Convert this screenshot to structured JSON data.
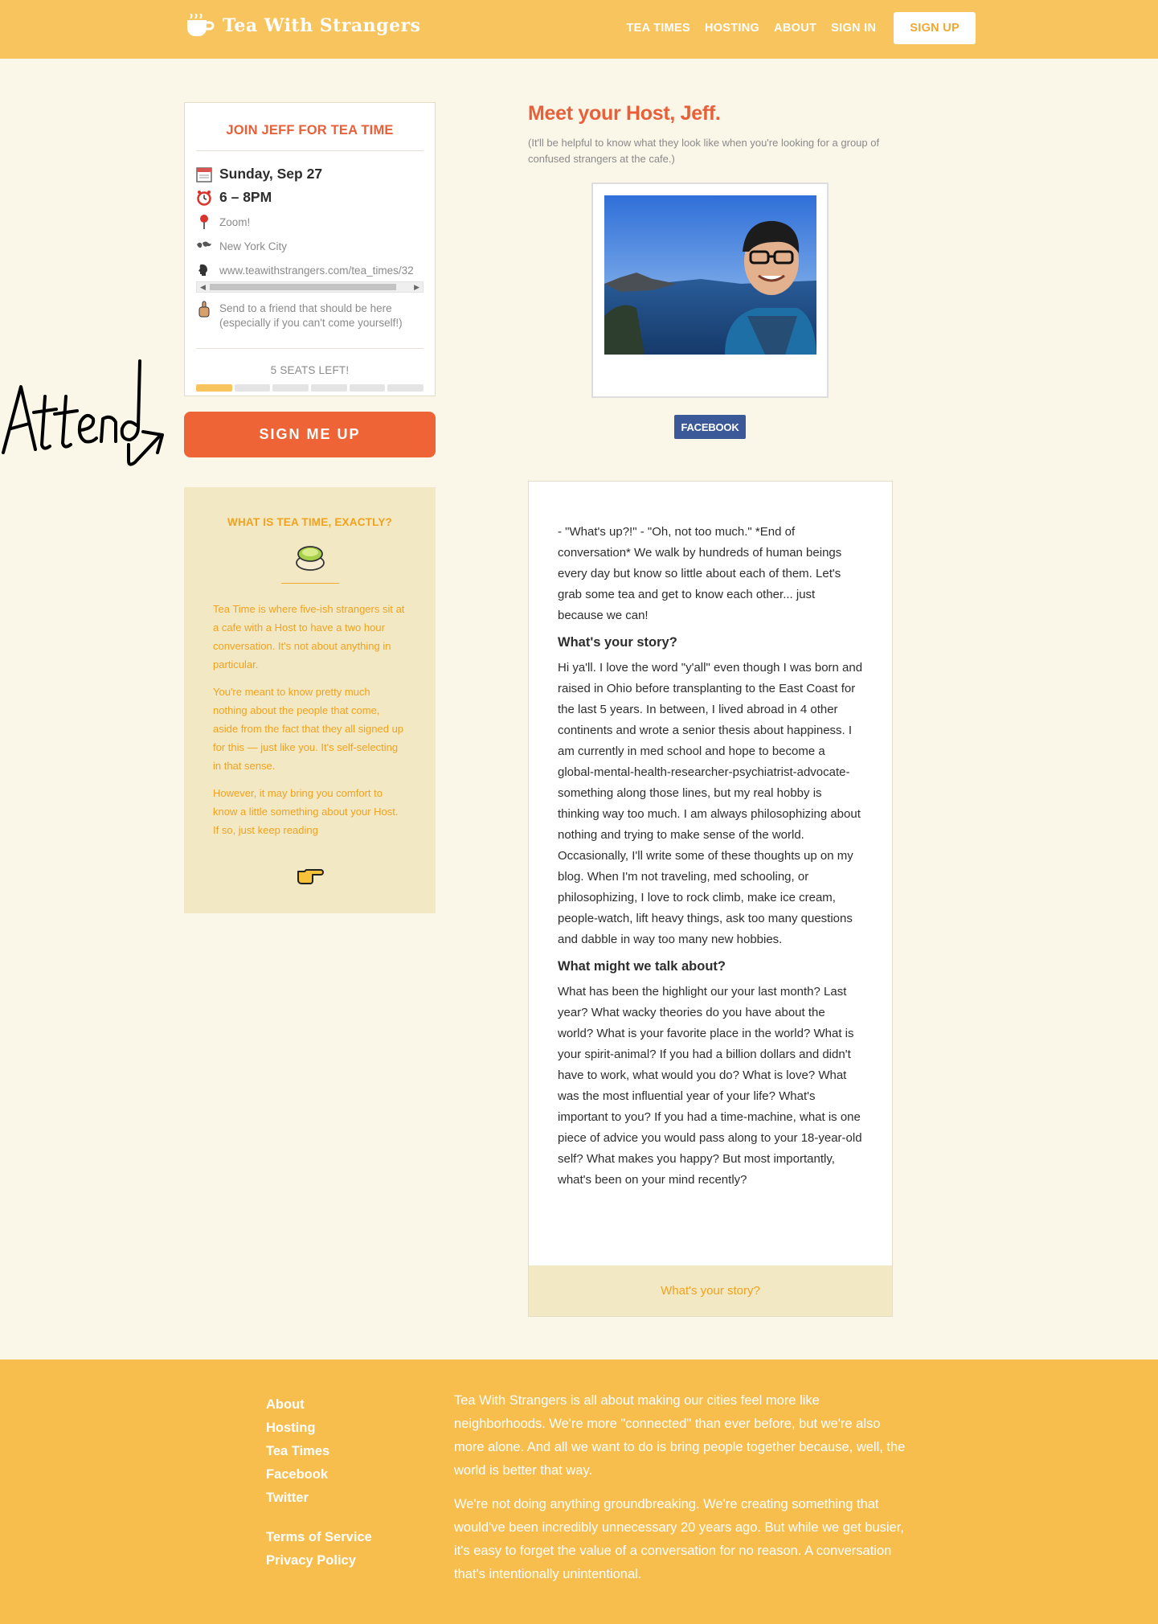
{
  "header": {
    "logo_text": "Tea With Strangers",
    "nav": {
      "tea_times": "TEA TIMES",
      "hosting": "HOSTING",
      "about": "ABOUT",
      "sign_in": "SIGN IN",
      "sign_up": "SIGN UP"
    }
  },
  "event_card": {
    "title": "JOIN JEFF FOR TEA TIME",
    "date": "Sunday, Sep 27",
    "time": "6 – 8PM",
    "location": "Zoom!",
    "city": "New York City",
    "url": "www.teawithstrangers.com/tea_times/32",
    "send_note_line1": "Send to a friend that should be here",
    "send_note_line2": "(especially if you can't come yourself!)",
    "seats_left": "5 SEATS LEFT!",
    "seats_filled_fraction": 0.1667,
    "icons": {
      "date": "calendar-icon",
      "time": "alarm-clock-icon",
      "location": "pushpin-icon",
      "city": "world-map-icon",
      "url": "speaking-head-icon",
      "send": "pointing-finger-icon"
    }
  },
  "sign_me_up_label": "SIGN ME UP",
  "scribble_text": "Attend",
  "explain": {
    "title": "WHAT IS TEA TIME, EXACTLY?",
    "p1": "Tea Time is where five-ish strangers sit at a cafe with a Host to have a two hour conversation. It's not about anything in particular.",
    "p2": "You're meant to know pretty much nothing about the people that come, aside from the fact that they all signed up for this — just like you. It's self-selecting in that sense.",
    "p3": "However, it may bring you comfort to know a little something about your Host. If so, just keep reading",
    "icons": {
      "top": "tea-cup-icon",
      "bottom": "pointing-hand-icon"
    }
  },
  "host": {
    "title": "Meet your Host, Jeff.",
    "subtitle": "(It'll be helpful to know what they look like when you're looking for a group of confused strangers at the cafe.)",
    "facebook_label": "FACEBOOK"
  },
  "story": {
    "intro": "- \"What's up?!\" - \"Oh, not too much.\" *End of conversation* We walk by hundreds of human beings every day but know so little about each of them. Let's grab some tea and get to know each other... just because we can!",
    "h1": "What's your story?",
    "p1": "Hi ya'll. I love the word \"y'all\" even though I was born and raised in Ohio before transplanting to the East Coast for the last 5 years. In between, I lived abroad in 4 other continents and wrote a senior thesis about happiness. I am currently in med school and hope to become a global-mental-health-researcher-psychiatrist-advocate-something along those lines, but my real hobby is thinking way too much. I am always philosophizing about nothing and trying to make sense of the world. Occasionally, I'll write some of these thoughts up on my blog. When I'm not traveling, med schooling, or philosophizing, I love to rock climb, make ice cream, people-watch, lift heavy things, ask too many questions and dabble in way too many new hobbies.",
    "h2": "What might we talk about?",
    "p2": "What has been the highlight our your last month? Last year? What wacky theories do you have about the world? What is your favorite place in the world? What is your spirit-animal? If you had a billion dollars and didn't have to work, what would you do? What is love? What was the most influential year of your life? What's important to you? If you had a time-machine, what is one piece of advice you would pass along to your 18-year-old self? What makes you happy? But most importantly, what's been on your mind recently?",
    "footer_link": "What's your story?"
  },
  "footer": {
    "links": {
      "about": "About",
      "hosting": "Hosting",
      "tea_times": "Tea Times",
      "facebook": "Facebook",
      "twitter": "Twitter",
      "terms": "Terms of Service",
      "privacy": "Privacy Policy"
    },
    "p1": "Tea With Strangers is all about making our cities feel more like neighborhoods. We're more \"connected\" than ever before, but we're also more alone. And all we want to do is bring people together because, well, the world is better that way.",
    "p2": "We're not doing anything groundbreaking. We're creating something that would've been incredibly unnecessary 20 years ago. But while we get busier, it's easy to forget the value of a conversation for no reason. A conversation that's intentionally unintentional."
  },
  "colors": {
    "header_bg": "#f7c45e",
    "accent_orange": "#ef6436",
    "page_bg": "#faf6e8",
    "tan_panel": "#f3e8c4",
    "facebook_blue": "#3b5998"
  }
}
